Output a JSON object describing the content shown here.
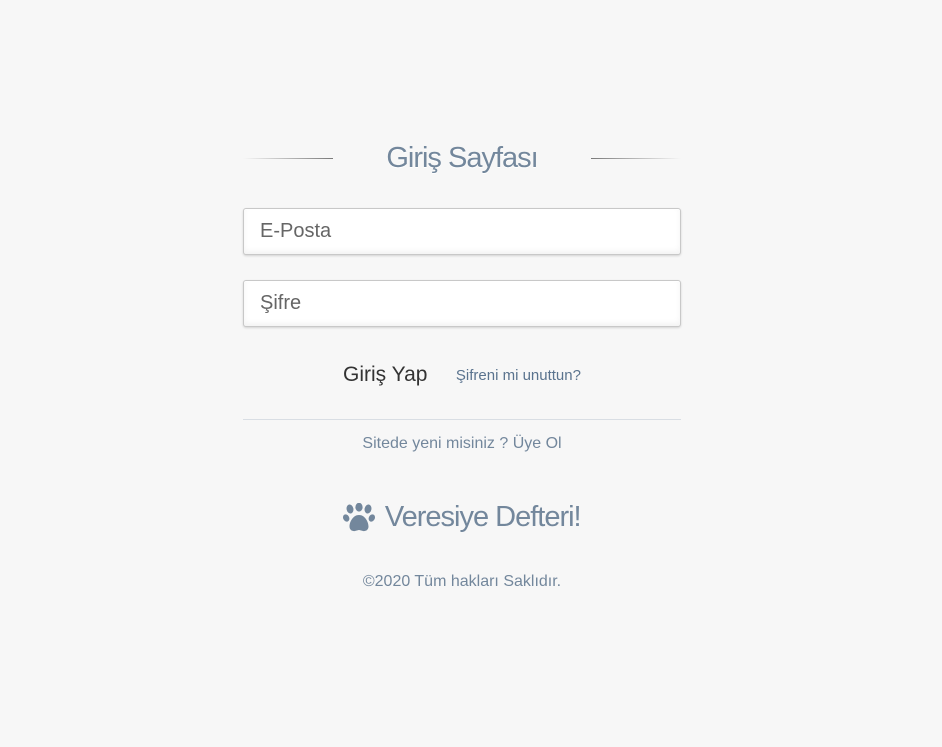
{
  "login": {
    "title": "Giriş Sayfası",
    "email_placeholder": "E-Posta",
    "password_placeholder": "Şifre",
    "submit_label": "Giriş Yap",
    "forgot_label": "Şifreni mi unuttun?"
  },
  "register": {
    "prompt": "Sitede yeni misiniz ?",
    "link_label": "Üye Ol"
  },
  "brand": {
    "icon": "paw-icon",
    "name": "Veresiye Defteri!"
  },
  "footer": {
    "copyright": "©2020 Tüm hakları Saklıdır."
  },
  "colors": {
    "background": "#f7f7f7",
    "accent_text": "#73879c",
    "link": "#5a738e"
  }
}
